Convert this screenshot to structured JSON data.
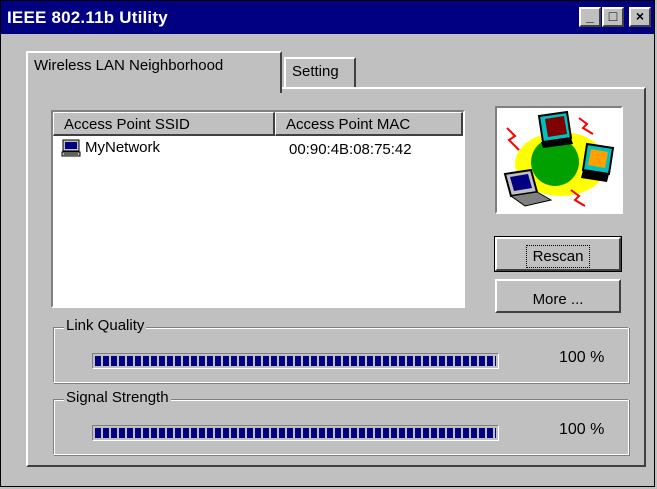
{
  "window": {
    "title": "IEEE 802.11b Utility",
    "controls": {
      "minimize": "_",
      "maximize": "□",
      "close": "×"
    }
  },
  "tabs": [
    {
      "label": "Wireless LAN Neighborhood",
      "active": true
    },
    {
      "label": "Setting",
      "active": false
    }
  ],
  "ap_list": {
    "columns": [
      "Access Point SSID",
      "Access Point MAC"
    ],
    "rows": [
      {
        "ssid": "MyNetwork",
        "mac": "00:90:4B:08:75:42",
        "icon": "network-computer-icon"
      }
    ]
  },
  "illustration": {
    "icon": "wireless-network-illustration-icon"
  },
  "buttons": {
    "rescan": "Rescan",
    "more": "More ..."
  },
  "link_quality": {
    "label": "Link Quality",
    "value_text": "100 %",
    "level": 1.0
  },
  "signal_strength": {
    "label": "Signal Strength",
    "value_text": "100 %",
    "level": 1.0
  },
  "colors": {
    "titlebar": "#000080",
    "face": "#c0c0c0",
    "meter_fill": "#000080"
  }
}
